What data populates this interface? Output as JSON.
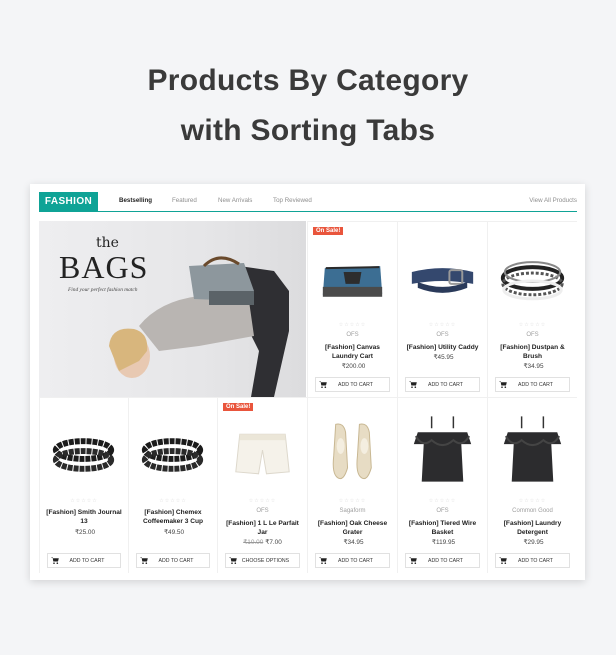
{
  "headline": {
    "line1": "Products By Category",
    "line2": "with Sorting Tabs"
  },
  "module": {
    "category": "FASHION",
    "tabs": [
      {
        "label": "Bestselling",
        "active": true
      },
      {
        "label": "Featured",
        "active": false
      },
      {
        "label": "New Arrivals",
        "active": false
      },
      {
        "label": "Top Reviewed",
        "active": false
      }
    ],
    "view_all": "View All Products",
    "accent_color": "#0fa396",
    "sale_color": "#e9553c"
  },
  "banner": {
    "the": "the",
    "title": "BAGS",
    "subtitle": "Find your perfect fashion match"
  },
  "products": [
    {
      "name": "[Fashion] Canvas Laundry Cart",
      "brand": "OFS",
      "price": "₹200.00",
      "old_price": "",
      "sale_badge": "On Sale!",
      "button": "ADD TO CART",
      "icon": "toiletry-bag-icon"
    },
    {
      "name": "[Fashion] Utility Caddy",
      "brand": "OFS",
      "price": "₹45.95",
      "old_price": "",
      "sale_badge": "",
      "button": "ADD TO CART",
      "icon": "belt-icon"
    },
    {
      "name": "[Fashion] Dustpan & Brush",
      "brand": "OFS",
      "price": "₹34.95",
      "old_price": "",
      "sale_badge": "",
      "button": "ADD TO CART",
      "icon": "bracelets-icon"
    },
    {
      "name": "[Fashion] Smith Journal 13",
      "brand": "",
      "price": "₹25.00",
      "old_price": "",
      "sale_badge": "",
      "button": "ADD TO CART",
      "icon": "bead-bracelet-icon"
    },
    {
      "name": "[Fashion] Chemex Coffeemaker 3 Cup",
      "brand": "",
      "price": "₹49.50",
      "old_price": "",
      "sale_badge": "",
      "button": "ADD TO CART",
      "icon": "bead-bracelet-icon"
    },
    {
      "name": "[Fashion] 1 L Le Parfait Jar",
      "brand": "OFS",
      "price": "₹7.00",
      "old_price": "₹10.00",
      "sale_badge": "On Sale!",
      "button": "CHOOSE OPTIONS",
      "icon": "shorts-icon"
    },
    {
      "name": "[Fashion] Oak Cheese Grater",
      "brand": "Sagaform",
      "price": "₹34.95",
      "old_price": "",
      "sale_badge": "",
      "button": "ADD TO CART",
      "icon": "flats-icon"
    },
    {
      "name": "[Fashion] Tiered Wire Basket",
      "brand": "OFS",
      "price": "₹119.95",
      "old_price": "",
      "sale_badge": "",
      "button": "ADD TO CART",
      "icon": "ruffle-top-icon"
    },
    {
      "name": "[Fashion] Laundry Detergent",
      "brand": "Common Good",
      "price": "₹29.95",
      "old_price": "",
      "sale_badge": "",
      "button": "ADD TO CART",
      "icon": "ruffle-top-icon"
    }
  ]
}
